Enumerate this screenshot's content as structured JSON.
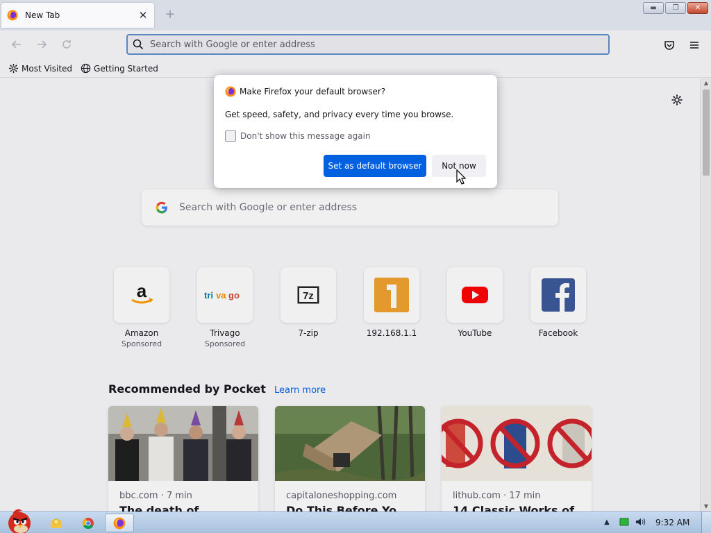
{
  "window": {
    "tab_title": "New Tab",
    "tab_close": "✕",
    "new_tab": "+"
  },
  "navbar": {
    "url_placeholder": "Search with Google or enter address"
  },
  "bookmarks": [
    {
      "label": "Most Visited",
      "icon": "gear-icon"
    },
    {
      "label": "Getting Started",
      "icon": "globe-icon"
    }
  ],
  "dialog": {
    "title": "Make Firefox your default browser?",
    "body": "Get speed, safety, and privacy every time you browse.",
    "checkbox_label": "Don't show this message again",
    "checkbox_checked": false,
    "primary_button": "Set as default browser",
    "secondary_button": "Not now"
  },
  "newtab": {
    "search_placeholder": "Search with Google or enter address",
    "top_sites": [
      {
        "label": "Amazon",
        "sponsor": "Sponsored",
        "icon": "amazon-icon"
      },
      {
        "label": "Trivago",
        "sponsor": "Sponsored",
        "icon": "trivago-icon"
      },
      {
        "label": "7-zip",
        "sponsor": "",
        "icon": "7zip-icon"
      },
      {
        "label": "192.168.1.1",
        "sponsor": "",
        "icon": "tile-1-icon"
      },
      {
        "label": "YouTube",
        "sponsor": "",
        "icon": "youtube-icon"
      },
      {
        "label": "Facebook",
        "sponsor": "",
        "icon": "facebook-icon"
      }
    ],
    "pocket_title": "Recommended by Pocket",
    "pocket_learn_more": "Learn more",
    "cards": [
      {
        "source": "bbc.com · 7 min",
        "headline": "The death of..."
      },
      {
        "source": "capitaloneshopping.com",
        "headline": "Do This Before Yo..."
      },
      {
        "source": "lithub.com · 17 min",
        "headline": "14 Classic Works of..."
      }
    ]
  },
  "taskbar": {
    "clock": "9:32 AM"
  },
  "colors": {
    "accent": "#0061e0",
    "urlbar_focus": "#5e8fc9"
  }
}
